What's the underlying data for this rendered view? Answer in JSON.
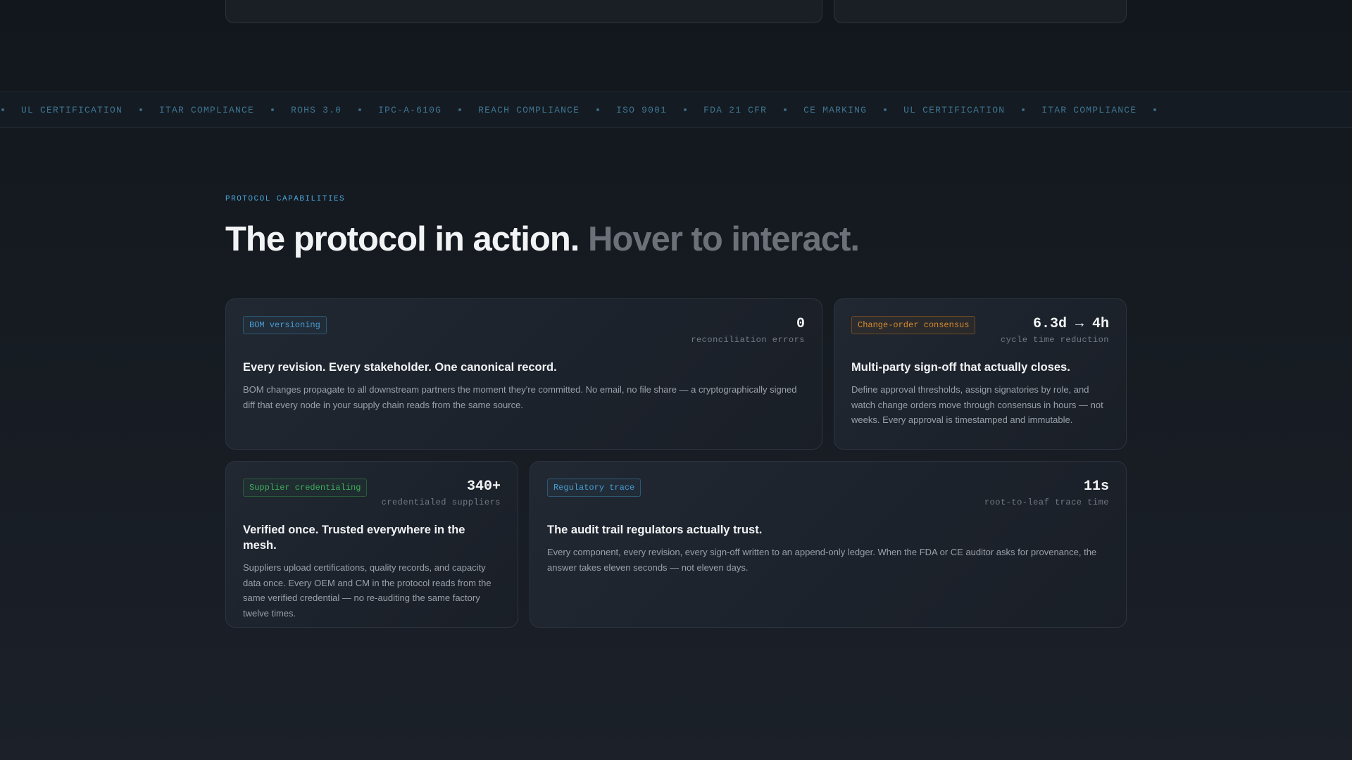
{
  "ticker": {
    "items": [
      "UL CERTIFICATION",
      "ITAR COMPLIANCE",
      "ROHS 3.0",
      "IPC-A-610G",
      "REACH COMPLIANCE",
      "ISO 9001",
      "FDA 21 CFR",
      "CE MARKING",
      "UL CERTIFICATION",
      "ITAR COMPLIANCE"
    ]
  },
  "section": {
    "eyebrow": "PROTOCOL CAPABILITIES",
    "headline_lead": "The protocol in action.",
    "headline_muted": "Hover to interact."
  },
  "cards": {
    "bom": {
      "tag": "BOM versioning",
      "metric_value": "0",
      "metric_label": "reconciliation errors",
      "title": "Every revision. Every stakeholder. One canonical record.",
      "body": "BOM changes propagate to all downstream partners the moment they're committed. No email, no file share — a cryptographically signed diff that every node in your supply chain reads from the same source."
    },
    "change_order": {
      "tag": "Change-order consensus",
      "metric_value": "6.3d → 4h",
      "metric_label": "cycle time reduction",
      "title": "Multi-party sign-off that actually closes.",
      "body": "Define approval thresholds, assign signatories by role, and watch change orders move through consensus in hours — not weeks. Every approval is timestamped and immutable."
    },
    "supplier": {
      "tag": "Supplier credentialing",
      "metric_value": "340+",
      "metric_label": "credentialed suppliers",
      "title": "Verified once. Trusted everywhere in the mesh.",
      "body": "Suppliers upload certifications, quality records, and capacity data once. Every OEM and CM in the protocol reads from the same verified credential — no re-auditing the same factory twelve times."
    },
    "regulatory": {
      "tag": "Regulatory trace",
      "metric_value": "11s",
      "metric_label": "root-to-leaf trace time",
      "title": "The audit trail regulators actually trust.",
      "body": "Every component, every revision, every sign-off written to an append-only ledger. When the FDA or CE auditor asks for provenance, the answer takes eleven seconds — not eleven days."
    }
  },
  "colors": {
    "accent_blue": "#4a9ccd",
    "accent_amber": "#d48a2e",
    "accent_green": "#3fae5e",
    "background": "#161b22"
  }
}
